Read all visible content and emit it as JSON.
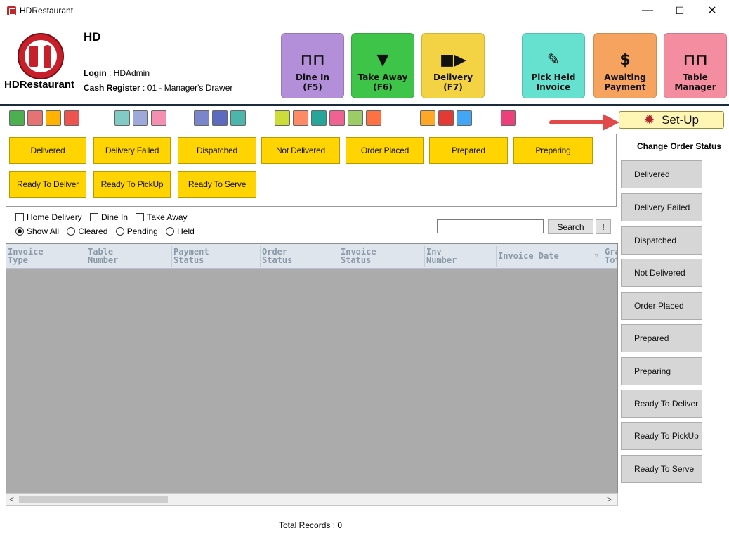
{
  "window": {
    "title": "HDRestaurant",
    "minimize_glyph": "—",
    "maximize_glyph": "☐",
    "close_glyph": "✕"
  },
  "header": {
    "company": "HD",
    "brand": "HDRestaurant",
    "login_label": "Login",
    "login_value": ": HDAdmin",
    "register_label": "Cash Register",
    "register_value": ": 01 - Manager's Drawer",
    "buttons": [
      {
        "line1": "Dine In",
        "line2": "(F5)",
        "icon": "table-icon",
        "color": "#b38fd9"
      },
      {
        "line1": "Take Away",
        "line2": "(F6)",
        "icon": "cup-icon",
        "color": "#3fc44a"
      },
      {
        "line1": "Delivery",
        "line2": "(F7)",
        "icon": "truck-icon",
        "color": "#f3d243"
      },
      {
        "line1": "Pick Held",
        "line2": "Invoice",
        "icon": "note-icon",
        "color": "#66e0cf"
      },
      {
        "line1": "Awaiting",
        "line2": "Payment",
        "icon": "money-icon",
        "color": "#f6a35f"
      },
      {
        "line1": "Table",
        "line2": "Manager",
        "icon": "table-manager-icon",
        "color": "#f58da0"
      }
    ]
  },
  "toolbar": {
    "setup_label": "Set-Up"
  },
  "status_buttons": [
    "Delivered",
    "Delivery Failed",
    "Dispatched",
    "Not Delivered",
    "Order Placed",
    "Prepared",
    "Preparing",
    "Ready To Deliver",
    "Ready To PickUp",
    "Ready To Serve"
  ],
  "filters": {
    "checkboxes": [
      "Home Delivery",
      "Dine In",
      "Take Away"
    ],
    "radios": [
      "Show All",
      "Cleared",
      "Pending",
      "Held"
    ],
    "selected_radio": "Show All",
    "search_value": "",
    "search_label": "Search",
    "bang_label": "!"
  },
  "grid": {
    "columns": [
      [
        "Invoice",
        "Type"
      ],
      [
        "Table",
        "Number"
      ],
      [
        "Payment",
        "Status"
      ],
      [
        "Order",
        "Status"
      ],
      [
        "Invoice",
        "Status"
      ],
      [
        "Inv",
        "Number"
      ],
      [
        "Invoice Date",
        ""
      ],
      [
        "Gra",
        "Tot"
      ]
    ],
    "scroll_left": "<",
    "scroll_right": ">"
  },
  "total_records": "Total Records : 0",
  "right_panel": {
    "title": "Change Order Status",
    "buttons": [
      "Delivered",
      "Delivery Failed",
      "Dispatched",
      "Not Delivered",
      "Order Placed",
      "Prepared",
      "Preparing",
      "Ready To Deliver",
      "Ready To PickUp",
      "Ready To Serve"
    ]
  }
}
